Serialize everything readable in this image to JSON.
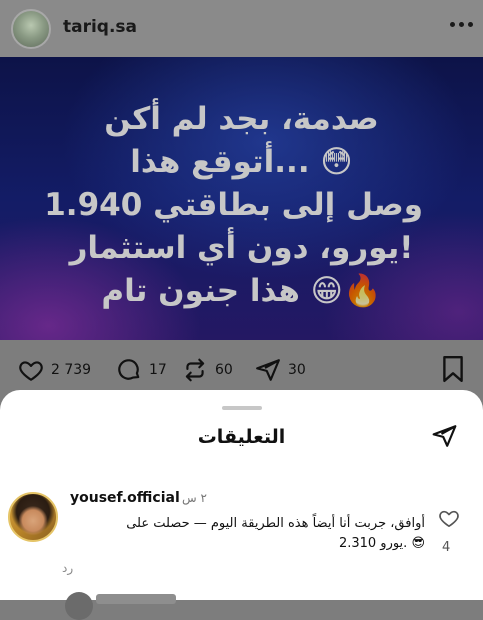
{
  "post": {
    "username": "tariq.sa",
    "image_text_lines": [
      "صدمة، بجد لم أكن",
      "😳 ...أتوقع هذا",
      "وصل إلى بطاقتي 1.940",
      "!يورو، دون أي استثمار",
      "🔥😁 هذا جنون تام"
    ],
    "likes": "2 739",
    "comments": "17",
    "reposts": "60",
    "shares": "30"
  },
  "comments_sheet": {
    "title": "التعليقات",
    "comments": [
      {
        "username": "yousef.official",
        "time": "٢ س",
        "text_lines": [
          "أوافق، جربت أنا أيضاً هذه الطريقة اليوم — حصلت على",
          "😎 .يورو 2.310"
        ],
        "reply_label": "رد",
        "like_count": "4"
      }
    ]
  },
  "colors": {
    "overlay": "#7d7d7d",
    "image_top": "#0d1348",
    "image_bottom": "#241863",
    "sheet": "#ffffff"
  },
  "icons": [
    "more-icon",
    "heart-icon",
    "comment-icon",
    "repost-icon",
    "share-icon",
    "bookmark-icon",
    "send-icon",
    "like-icon"
  ]
}
